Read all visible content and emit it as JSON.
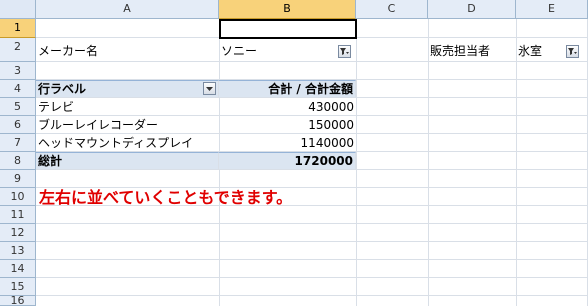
{
  "columns": [
    "A",
    "B",
    "C",
    "D",
    "E"
  ],
  "rows": [
    "1",
    "2",
    "3",
    "4",
    "5",
    "6",
    "7",
    "8",
    "9",
    "10",
    "11",
    "12",
    "13",
    "14",
    "15",
    "16"
  ],
  "filters": {
    "maker_label": "メーカー名",
    "maker_value": "ソニー",
    "sales_label": "販売担当者",
    "sales_value": "氷室"
  },
  "pivot": {
    "row_label_header": "行ラベル",
    "value_header": "合計 / 合計金額",
    "items": [
      {
        "label": "テレビ",
        "value": "430000"
      },
      {
        "label": "ブルーレイレコーダー",
        "value": "150000"
      },
      {
        "label": "ヘッドマウントディスプレイ",
        "value": "1140000"
      }
    ],
    "total_label": "総計",
    "total_value": "1720000"
  },
  "note": "左右に並べていくこともできます。",
  "icons": {
    "filter": "funnel-filter-icon",
    "dropdown": "dropdown-arrow-icon"
  },
  "colors": {
    "header_bg": "#e4ecf7",
    "selected_header": "#f8d27a",
    "pivot_band": "#dbe5f1",
    "note_red": "#e00000"
  }
}
